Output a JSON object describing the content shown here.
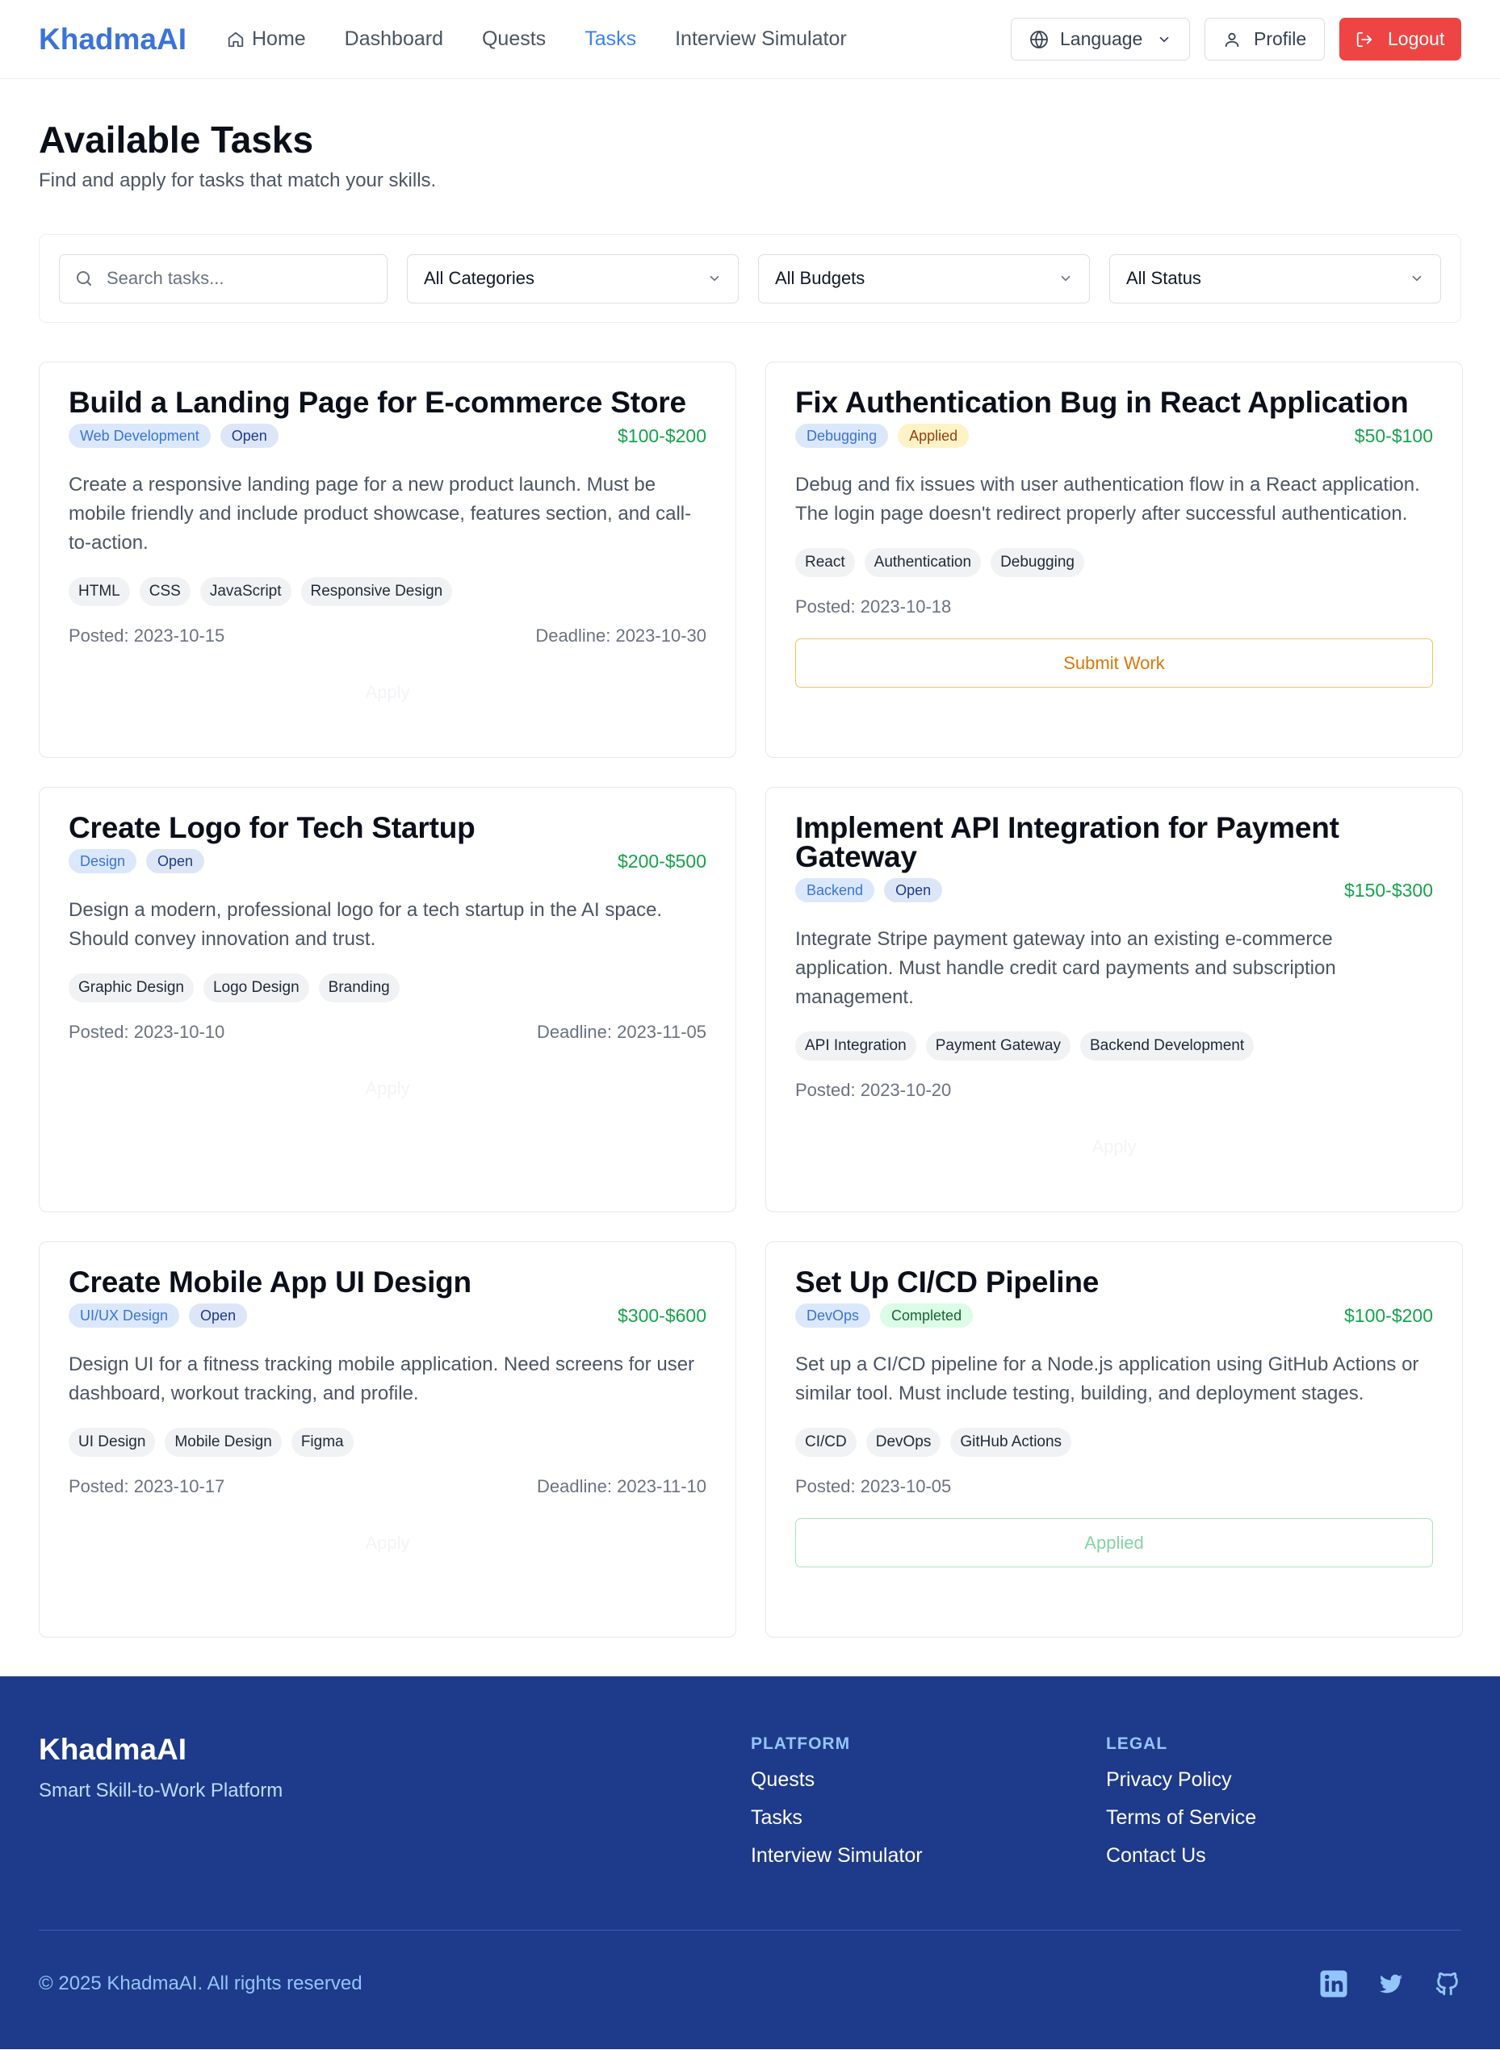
{
  "nav": {
    "brand": "KhadmaAI",
    "links": [
      {
        "label": "Home"
      },
      {
        "label": "Dashboard"
      },
      {
        "label": "Quests"
      },
      {
        "label": "Tasks"
      },
      {
        "label": "Interview Simulator"
      }
    ],
    "language_label": "Language",
    "profile_label": "Profile",
    "logout_label": "Logout"
  },
  "header": {
    "title": "Available Tasks",
    "subtitle": "Find and apply for tasks that match your skills."
  },
  "filters": {
    "search_placeholder": "Search tasks...",
    "category": "All Categories",
    "budget": "All Budgets",
    "status": "All Status"
  },
  "tasks": [
    {
      "title": "Build a Landing Page for E-commerce Store",
      "category": "Web Development",
      "status": "Open",
      "budget": "$100-$200",
      "description": "Create a responsive landing page for a new product launch. Must be mobile friendly and include product showcase, features section, and call-to-action.",
      "skills": [
        "HTML",
        "CSS",
        "JavaScript",
        "Responsive Design"
      ],
      "posted": "Posted: 2023-10-15",
      "deadline": "Deadline: 2023-10-30",
      "action": "Apply"
    },
    {
      "title": "Fix Authentication Bug in React Application",
      "category": "Debugging",
      "status": "Applied",
      "budget": "$50-$100",
      "description": "Debug and fix issues with user authentication flow in a React application. The login page doesn't redirect properly after successful authentication.",
      "skills": [
        "React",
        "Authentication",
        "Debugging"
      ],
      "posted": "Posted: 2023-10-18",
      "action": "Submit Work"
    },
    {
      "title": "Create Logo for Tech Startup",
      "category": "Design",
      "status": "Open",
      "budget": "$200-$500",
      "description": "Design a modern, professional logo for a tech startup in the AI space. Should convey innovation and trust.",
      "skills": [
        "Graphic Design",
        "Logo Design",
        "Branding"
      ],
      "posted": "Posted: 2023-10-10",
      "deadline": "Deadline: 2023-11-05",
      "action": "Apply"
    },
    {
      "title": "Implement API Integration for Payment Gateway",
      "category": "Backend",
      "status": "Open",
      "budget": "$150-$300",
      "description": "Integrate Stripe payment gateway into an existing e-commerce application. Must handle credit card payments and subscription management.",
      "skills": [
        "API Integration",
        "Payment Gateway",
        "Backend Development"
      ],
      "posted": "Posted: 2023-10-20",
      "action": "Apply"
    },
    {
      "title": "Create Mobile App UI Design",
      "category": "UI/UX Design",
      "status": "Open",
      "budget": "$300-$600",
      "description": "Design UI for a fitness tracking mobile application. Need screens for user dashboard, workout tracking, and profile.",
      "skills": [
        "UI Design",
        "Mobile Design",
        "Figma"
      ],
      "posted": "Posted: 2023-10-17",
      "deadline": "Deadline: 2023-11-10",
      "action": "Apply"
    },
    {
      "title": "Set Up CI/CD Pipeline",
      "category": "DevOps",
      "status": "Completed",
      "budget": "$100-$200",
      "description": "Set up a CI/CD pipeline for a Node.js application using GitHub Actions or similar tool. Must include testing, building, and deployment stages.",
      "skills": [
        "CI/CD",
        "DevOps",
        "GitHub Actions"
      ],
      "posted": "Posted: 2023-10-05",
      "action": "Applied"
    }
  ],
  "footer": {
    "brand": "KhadmaAI",
    "tagline": "Smart Skill-to-Work Platform",
    "platform_heading": "PLATFORM",
    "platform_links": [
      "Quests",
      "Tasks",
      "Interview Simulator"
    ],
    "legal_heading": "LEGAL",
    "legal_links": [
      "Privacy Policy",
      "Terms of Service",
      "Contact Us"
    ],
    "copyright": "© 2025 KhadmaAI. All rights reserved",
    "socials": [
      "linkedin-icon",
      "twitter-icon",
      "github-icon"
    ]
  }
}
